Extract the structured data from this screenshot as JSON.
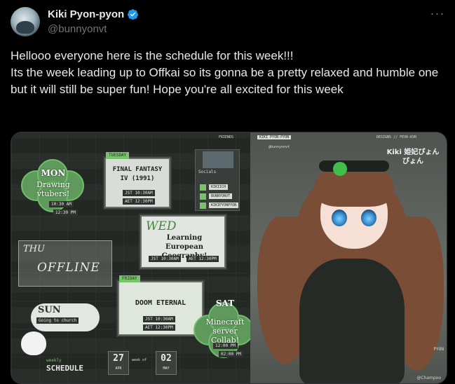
{
  "author": {
    "display_name": "Kiki Pyon-pyon",
    "handle": "@bunnyonvt",
    "verified_color": "#1d9bf0"
  },
  "more_label": "···",
  "tweet": {
    "lines": [
      "Hellooo everyone here is the schedule for this week!!!",
      "Its the week leading up to Offkai so its gonna be a pretty relaxed and humble one but it will still be super fun! Hope you're all excited for this week"
    ]
  },
  "schedule_image": {
    "mon": {
      "day": "MON",
      "title": "Drawing vtubers!",
      "time_a": "10:30 AM",
      "time_b": "12:30 PM"
    },
    "tue": {
      "tab": "TUESDAY",
      "title_a": "FINAL FANTASY",
      "title_b": "IV (1991)",
      "jst": "JST  10:30AM",
      "aet": "AET  12:30PM"
    },
    "wed": {
      "day": "WED",
      "title": "Learning European Geography!",
      "time_a": "JST 10:30AM",
      "time_b": "AET 12:30PM"
    },
    "thu": {
      "day": "THU",
      "status": "OFFLINE"
    },
    "fri": {
      "tab": "FRIDAY",
      "title": "DOOM ETERNAL",
      "jst": "JST  10:30AM",
      "aet": "AET  12:30PM"
    },
    "sat": {
      "day": "SAT",
      "title": "Minecraft server Collab!",
      "time_a": "12:00 PM",
      "time_b": "02:00 PM"
    },
    "sun": {
      "day": "SUN",
      "subtitle": "Going to church"
    },
    "socials": {
      "label": "Socials",
      "handles": [
        "KIKIICH",
        "BUNNYONVT",
        "KIKIPYONPYON"
      ]
    },
    "footer": {
      "label_top": "weekly",
      "label_main": "SCHEDULE",
      "start_day": "27",
      "start_month": "APR",
      "end_day": "02",
      "end_month": "MAY",
      "sep": "week of"
    },
    "top_bar": {
      "left": "FRIENDS",
      "mid": "KIKI PYON-PYON",
      "right": "DESIGNS // FEVR-KVR"
    },
    "handle_tag": "@bunnyonvt",
    "logo": "Kiki 姫妃ぴょんぴょん",
    "credit": "@Champoo",
    "corner": "PYON"
  },
  "colors": {
    "bg": "#000000",
    "text": "#e7e9ea",
    "muted": "#71767b",
    "accent_green": "#78c26a"
  }
}
